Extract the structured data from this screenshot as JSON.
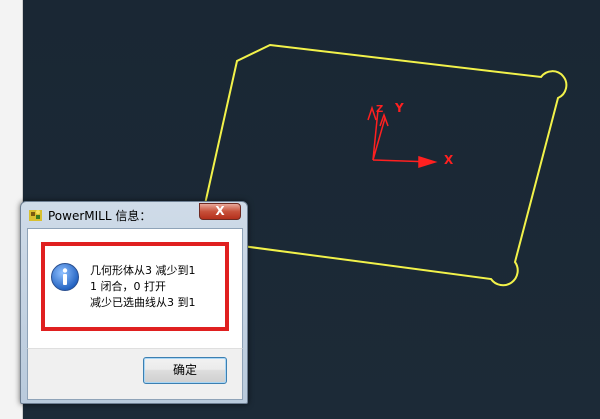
{
  "viewport": {
    "axes": {
      "x_label": "X",
      "y_label": "Y",
      "z_label": "Z"
    },
    "colors": {
      "geometry": "#f2f24a",
      "axes": "#ff2020",
      "background": "#1b2936"
    }
  },
  "dialog": {
    "title": "PowerMILL 信息：",
    "close_label": "X",
    "message_lines": [
      "几何形体从3 减少到1",
      "1 闭合，0 打开",
      "减少已选曲线从3 到1"
    ],
    "ok_label": "确定",
    "colors": {
      "highlight": "#e02020",
      "info_icon": "#1f5fbf"
    }
  }
}
